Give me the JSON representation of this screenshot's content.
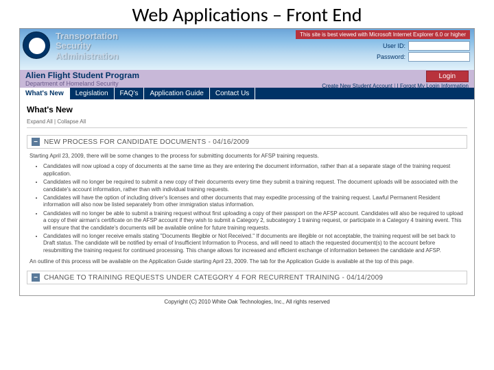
{
  "slide": {
    "title": "Web Applications – Front End"
  },
  "header": {
    "agency_line1": "Transportation",
    "agency_line2": "Security",
    "agency_line3": "Administration",
    "browser_note": "This site is best viewed with Microsoft Internet Explorer 6.0 or higher",
    "userid_label": "User ID:",
    "password_label": "Password:"
  },
  "program_bar": {
    "program": "Alien Flight Student Program",
    "department": "Department of Homeland Security",
    "login_button": "Login",
    "create_account": "Create New Student Account",
    "forgot": "I Forgot My Login Information"
  },
  "nav": {
    "items": [
      {
        "label": "What's New",
        "active": true
      },
      {
        "label": "Legislation",
        "active": false
      },
      {
        "label": "FAQ's",
        "active": false
      },
      {
        "label": "Application Guide",
        "active": false
      },
      {
        "label": "Contact Us",
        "active": false
      }
    ]
  },
  "content": {
    "section_title": "What's New",
    "expand_all": "Expand All",
    "collapse_all": "Collapse All",
    "articles": [
      {
        "title": "NEW PROCESS FOR CANDIDATE DOCUMENTS - 04/16/2009",
        "intro": "Starting April 23, 2009, there will be some changes to the process for submitting documents for AFSP training requests.",
        "bullets": [
          "Candidates will now upload a copy of documents at the same time as they are entering the document information, rather than at a separate stage of the training request application.",
          "Candidates will no longer be required to submit a new copy of their documents every time they submit a training request. The document uploads will be associated with the candidate's account information, rather than with individual training requests.",
          "Candidates will have the option of including driver's licenses and other documents that may expedite processing of the training request. Lawful Permanent Resident information will also now be listed separately from other immigration status information.",
          "Candidates will no longer be able to submit a training request without first uploading a copy of their passport on the AFSP account. Candidates will also be required to upload a copy of their airman's certificate on the AFSP account if they wish to submit a Category 2, subcategory 1 training request, or participate in a Category 4 training event. This will ensure that the candidate's documents will be available online for future training requests.",
          "Candidates will no longer receive emails stating \"Documents Illegible or Not Received.\" If documents are illegible or not acceptable, the training request will be set back to Draft status. The candidate will be notified by email of Insufficient Information to Process, and will need to attach the requested document(s) to the account before resubmitting the training request for continued processing. This change allows for increased and efficient exchange of information between the candidate and AFSP."
        ],
        "outro": "An outline of this process will be available on the Application Guide starting April 23, 2009. The tab for the Application Guide is available at the top of this page."
      },
      {
        "title": "CHANGE TO TRAINING REQUESTS UNDER CATEGORY 4 FOR RECURRENT TRAINING - 04/14/2009"
      }
    ]
  },
  "footer": {
    "copyright": "Copyright (C) 2010 White Oak Technologies, Inc., All rights reserved"
  }
}
